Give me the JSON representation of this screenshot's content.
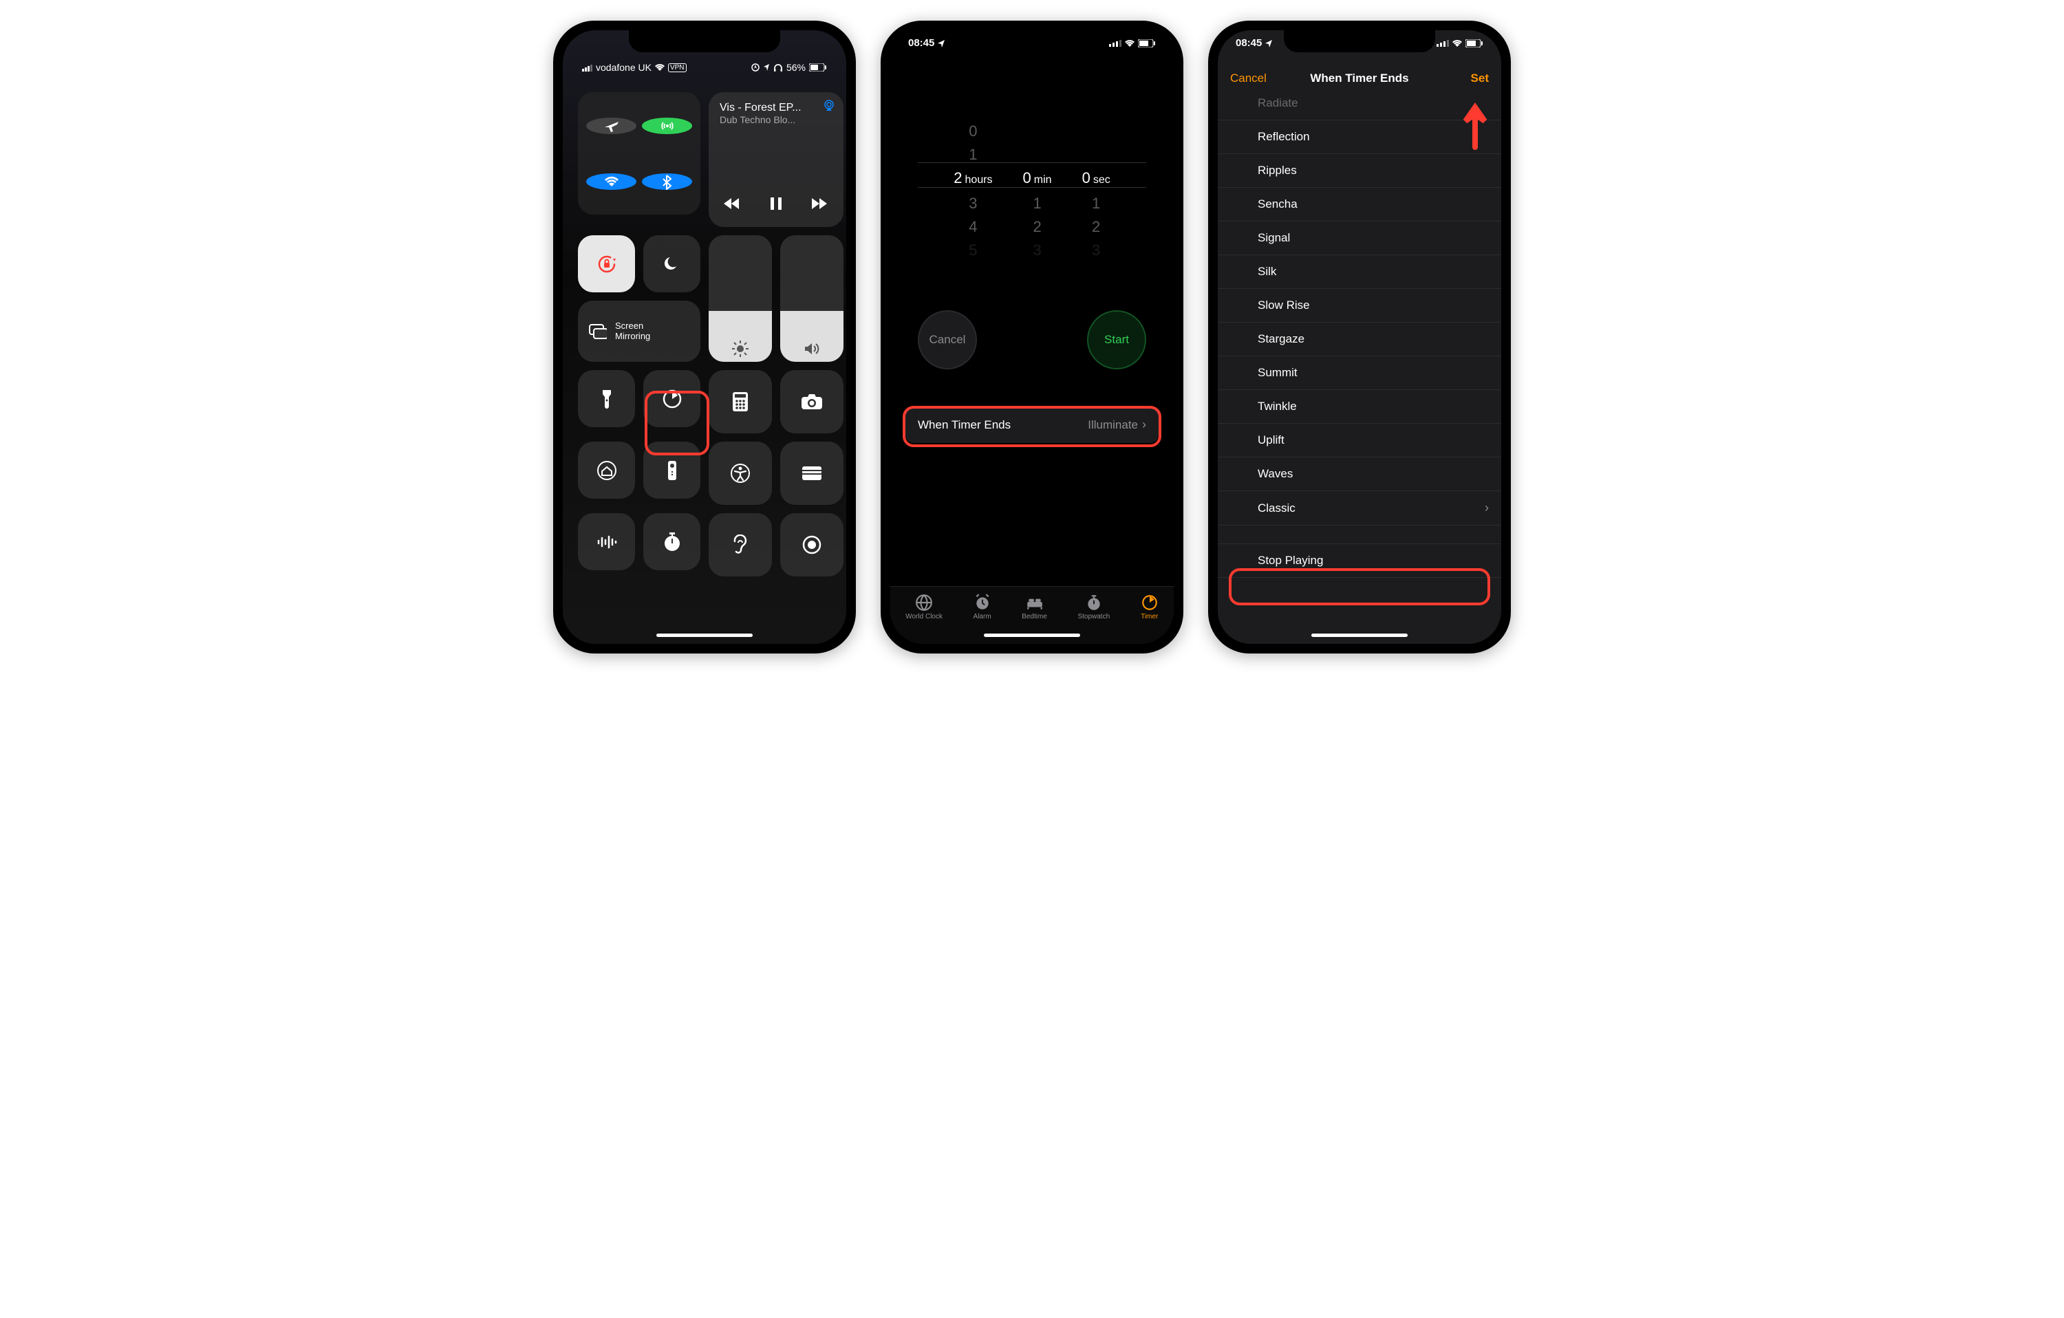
{
  "screen1": {
    "carrier": "vodafone UK",
    "vpn": "VPN",
    "battery": "56%",
    "media_title": "Vis - Forest EP...",
    "media_sub": "Dub Techno Blo...",
    "mirror_label": "Screen\nMirroring"
  },
  "screen2": {
    "time": "08:45",
    "picker_hours": [
      "0",
      "1",
      "2",
      "3",
      "4",
      "5"
    ],
    "picker_hours_sel": "2",
    "picker_min": [
      "0",
      "1",
      "2",
      "3"
    ],
    "picker_min_sel": "0",
    "picker_sec": [
      "0",
      "1",
      "2",
      "3"
    ],
    "picker_sec_sel": "0",
    "u_hours": "hours",
    "u_min": "min",
    "u_sec": "sec",
    "cancel": "Cancel",
    "start": "Start",
    "wte_label": "When Timer Ends",
    "wte_value": "Illuminate",
    "tabs": [
      "World Clock",
      "Alarm",
      "Bedtime",
      "Stopwatch",
      "Timer"
    ]
  },
  "screen3": {
    "time": "08:45",
    "cancel": "Cancel",
    "title": "When Timer Ends",
    "set": "Set",
    "sounds": [
      "Radiate",
      "Reflection",
      "Ripples",
      "Sencha",
      "Signal",
      "Silk",
      "Slow Rise",
      "Stargaze",
      "Summit",
      "Twinkle",
      "Uplift",
      "Waves",
      "Classic"
    ],
    "stop": "Stop Playing"
  }
}
